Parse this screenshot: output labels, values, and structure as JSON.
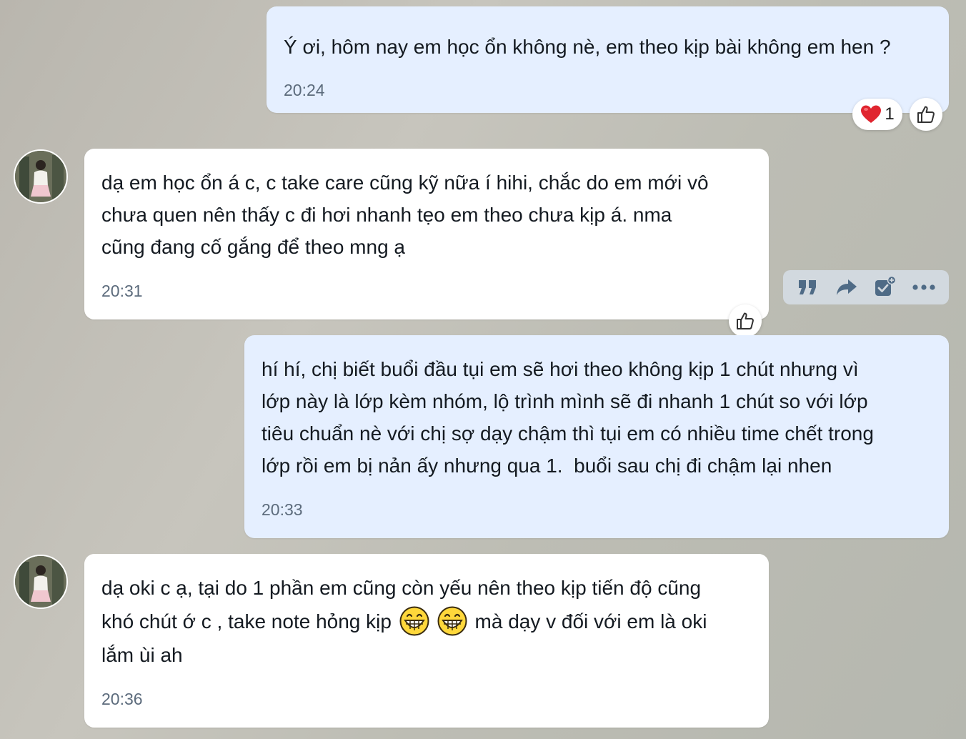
{
  "messages": [
    {
      "sender": "me",
      "text": "Ý ơi, hôm nay em học ổn không nè, em theo kịp bài không em hen ?",
      "time": "20:24",
      "reactions": [
        {
          "icon": "heart-icon",
          "count": "1"
        }
      ]
    },
    {
      "sender": "them",
      "text_lines": [
        "dạ em học ổn á c, c take care cũng kỹ nữa í hihi, chắc do em mới vô",
        "chưa quen nên thấy c đi hơi nhanh tẹo em theo chưa kịp á. nma",
        "cũng đang cố gắng để theo mng ạ"
      ],
      "time": "20:31"
    },
    {
      "sender": "me",
      "text_lines": [
        "hí hí, chị biết buổi đầu tụi em sẽ hơi theo không kịp 1 chút nhưng vì",
        "lớp này là lớp kèm nhóm, lộ trình mình sẽ đi nhanh 1 chút so với lớp",
        "tiêu chuẩn nè với chị sợ dạy chậm thì tụi em có nhiều time chết trong",
        "lớp rồi em bị nản ấy nhưng qua 1.  buổi sau chị đi chậm lại nhen"
      ],
      "time": "20:33"
    },
    {
      "sender": "them",
      "line1": "dạ oki c ạ, tại do 1 phần em cũng còn yếu nên theo kịp tiến độ cũng",
      "line2_before": "khó chút ớ c , take note hỏng kịp ",
      "line2_after": " mà dạy v đối với em là oki",
      "line3": "lắm ùi ah",
      "emojis": [
        "grinning-face-icon",
        "grinning-face-icon"
      ],
      "time": "20:36"
    }
  ],
  "toolbar": {
    "actions": [
      "quote-icon",
      "forward-icon",
      "add-task-icon",
      "more-icon"
    ]
  },
  "colors": {
    "outgoing_bubble": "#e5efff",
    "incoming_bubble": "#ffffff",
    "time_text": "#5c6b7c",
    "heart": "#e0252f"
  }
}
